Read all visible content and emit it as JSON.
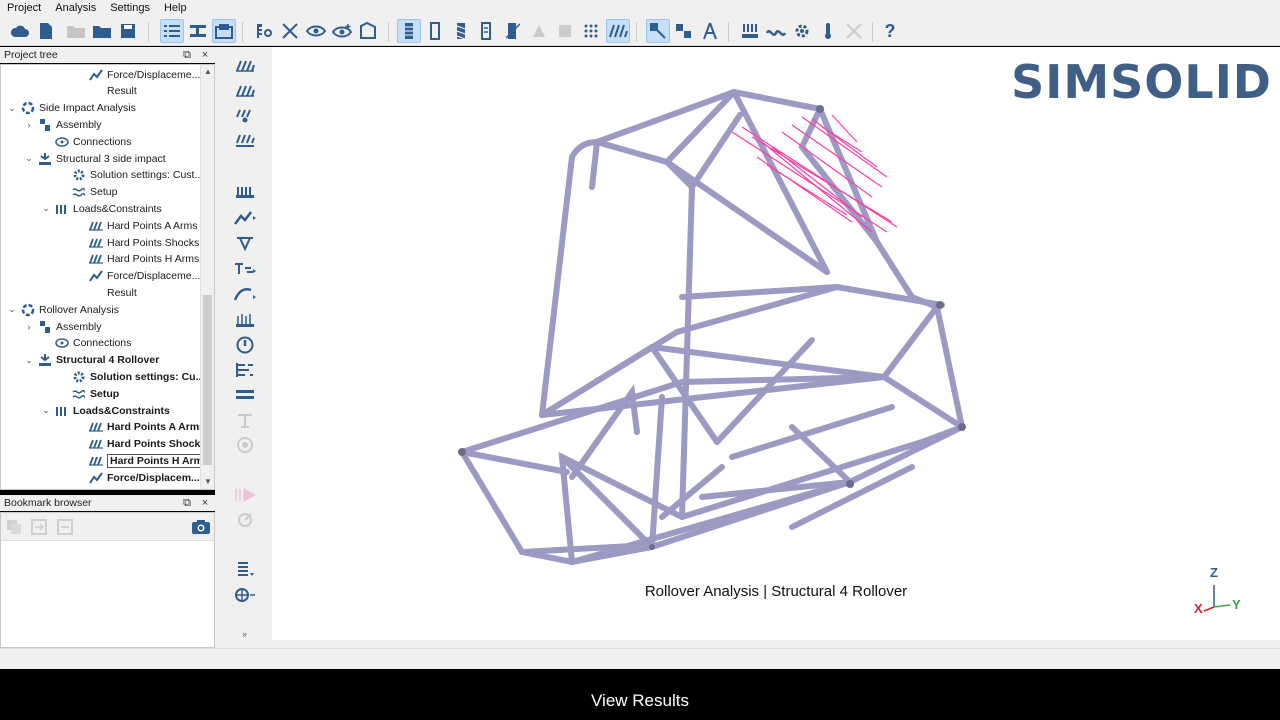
{
  "menu": [
    "Project",
    "Analysis",
    "Settings",
    "Help"
  ],
  "panels": {
    "project_tree_title": "Project tree",
    "bookmark_title": "Bookmark browser",
    "float_glyph": "⧉",
    "close_glyph": "×"
  },
  "tree": [
    {
      "label": "Force/Displaceme...",
      "indent": 88,
      "icon": "force-icon",
      "twisty": "",
      "bold": false
    },
    {
      "label": "Result",
      "indent": 88,
      "icon": "result-icon",
      "twisty": "",
      "bold": false
    },
    {
      "label": "Side Impact Analysis",
      "indent": 20,
      "icon": "analysis-icon",
      "twisty": "⌄",
      "bold": false
    },
    {
      "label": "Assembly",
      "indent": 37,
      "icon": "assembly-icon",
      "twisty": "›",
      "bold": false
    },
    {
      "label": "Connections",
      "indent": 54,
      "icon": "connections-icon",
      "twisty": "",
      "bold": false
    },
    {
      "label": "Structural  3  side impact",
      "indent": 37,
      "icon": "structural-icon",
      "twisty": "⌄",
      "bold": false
    },
    {
      "label": "Solution settings: Cust...",
      "indent": 71,
      "icon": "gear-icon",
      "twisty": "",
      "bold": false
    },
    {
      "label": "Setup",
      "indent": 71,
      "icon": "setup-icon",
      "twisty": "",
      "bold": false
    },
    {
      "label": "Loads&Constraints",
      "indent": 54,
      "icon": "loads-icon",
      "twisty": "⌄",
      "bold": false
    },
    {
      "label": "Hard Points A Arms",
      "indent": 88,
      "icon": "hardpoint-icon",
      "twisty": "",
      "bold": false
    },
    {
      "label": "Hard Points Shocks",
      "indent": 88,
      "icon": "hardpoint-icon",
      "twisty": "",
      "bold": false
    },
    {
      "label": "Hard Points H Arms",
      "indent": 88,
      "icon": "hardpoint-icon",
      "twisty": "",
      "bold": false
    },
    {
      "label": "Force/Displaceme...",
      "indent": 88,
      "icon": "force-icon",
      "twisty": "",
      "bold": false
    },
    {
      "label": "Result",
      "indent": 88,
      "icon": "result-icon",
      "twisty": "",
      "bold": false
    },
    {
      "label": "Rollover Analysis",
      "indent": 20,
      "icon": "analysis-icon",
      "twisty": "⌄",
      "bold": false
    },
    {
      "label": "Assembly",
      "indent": 37,
      "icon": "assembly-icon",
      "twisty": "›",
      "bold": false
    },
    {
      "label": "Connections",
      "indent": 54,
      "icon": "connections-icon",
      "twisty": "",
      "bold": false
    },
    {
      "label": "Structural 4 Rollover",
      "indent": 37,
      "icon": "structural-icon",
      "twisty": "⌄",
      "bold": true
    },
    {
      "label": "Solution settings: Cu...",
      "indent": 71,
      "icon": "gear-icon",
      "twisty": "",
      "bold": true
    },
    {
      "label": "Setup",
      "indent": 71,
      "icon": "setup-icon",
      "twisty": "",
      "bold": true
    },
    {
      "label": "Loads&Constraints",
      "indent": 54,
      "icon": "loads-icon",
      "twisty": "⌄",
      "bold": true
    },
    {
      "label": "Hard Points A Arms",
      "indent": 88,
      "icon": "hardpoint-icon",
      "twisty": "",
      "bold": true
    },
    {
      "label": "Hard Points Shocks",
      "indent": 88,
      "icon": "hardpoint-icon",
      "twisty": "",
      "bold": true
    },
    {
      "label": "Hard Points H Arms",
      "indent": 88,
      "icon": "hardpoint-icon",
      "twisty": "",
      "bold": true,
      "selected": true
    },
    {
      "label": "Force/Displacem...",
      "indent": 88,
      "icon": "force-icon",
      "twisty": "",
      "bold": true
    }
  ],
  "viewport": {
    "logo": "SIMSOLID",
    "caption": "Rollover Analysis | Structural 4 Rollover",
    "axes": {
      "z": "Z",
      "x": "X",
      "y": "Y"
    }
  },
  "subtitle": "View Results",
  "colors": {
    "accent": "#3f5f86",
    "frame": "#9a9ac2",
    "load_arrows": "#ff3fa4",
    "icon_blue": "#2f5d8f"
  }
}
